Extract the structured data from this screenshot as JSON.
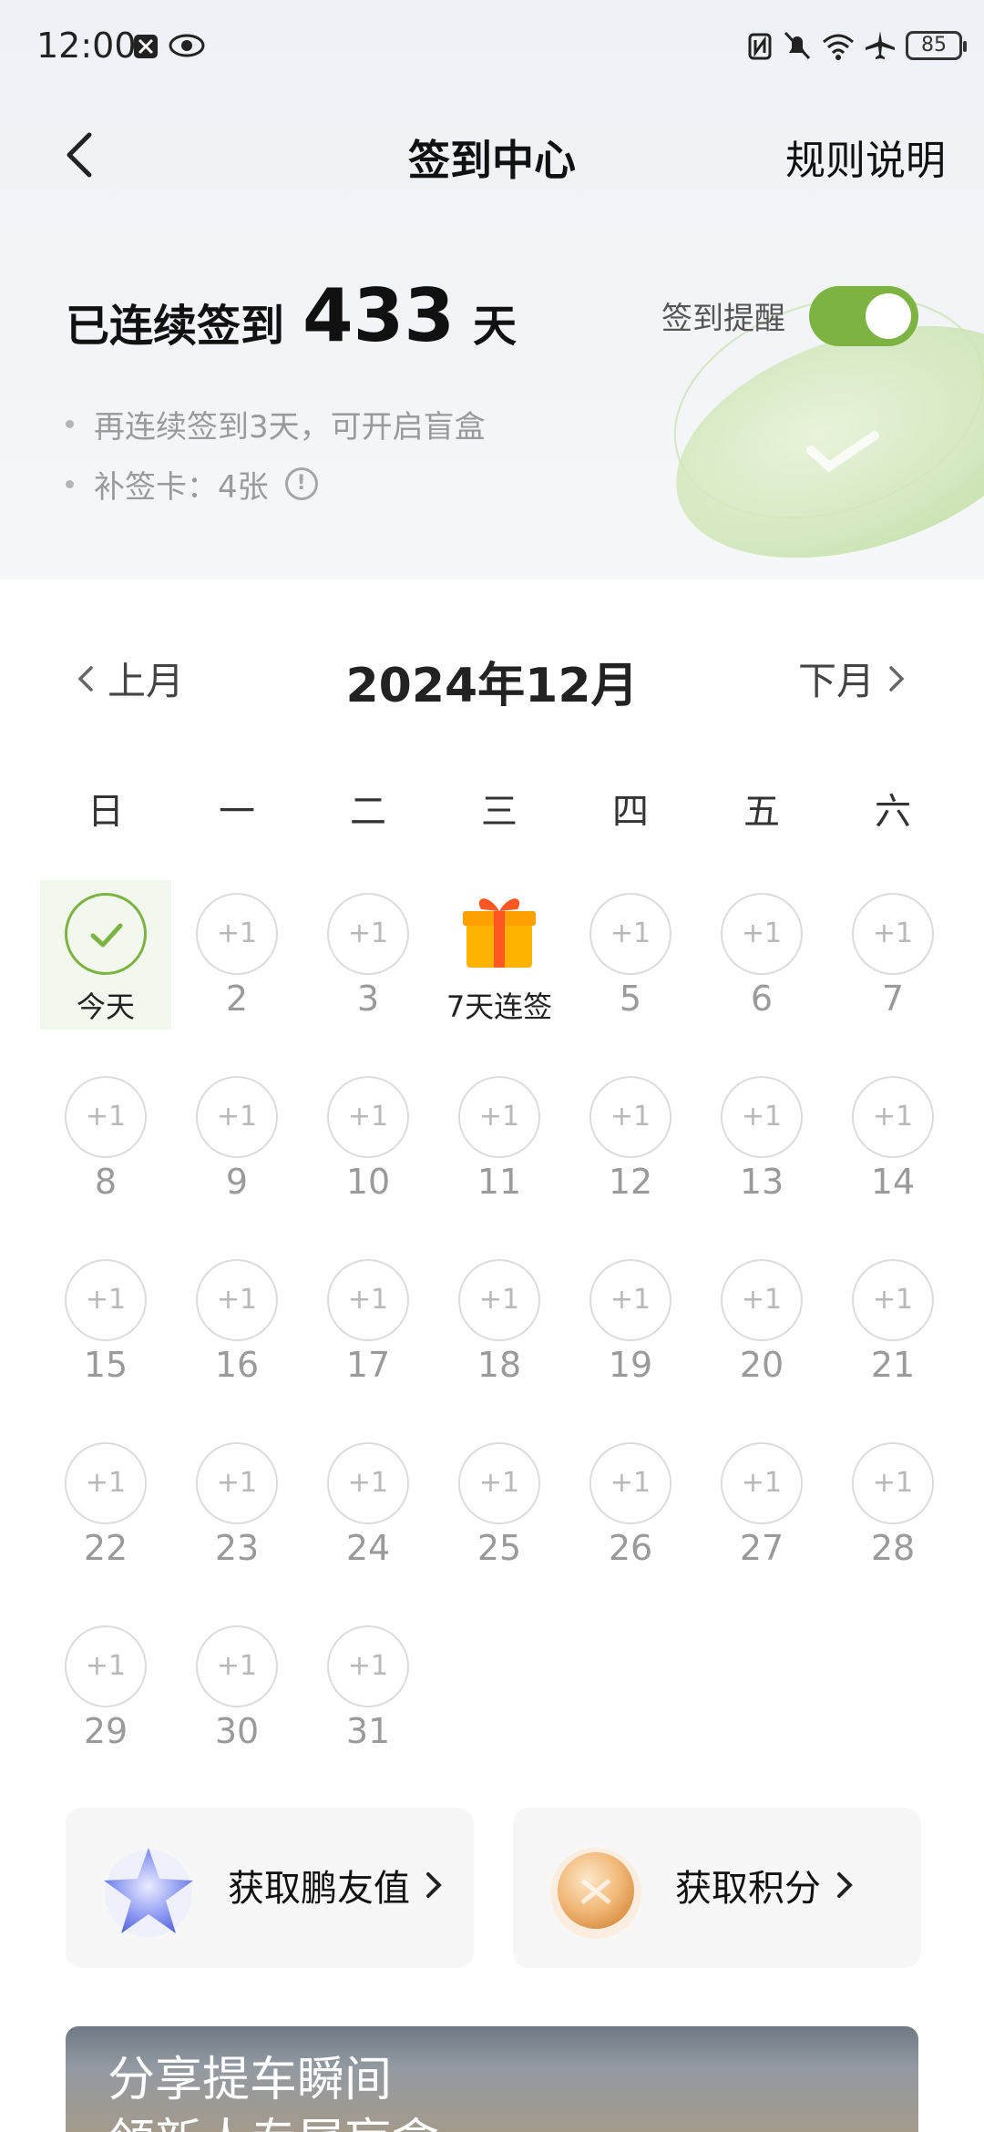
{
  "status_bar": {
    "time": "12:00",
    "battery": "85"
  },
  "header": {
    "title": "签到中心",
    "rules_link": "规则说明"
  },
  "streak": {
    "prefix": "已连续签到",
    "days": "433",
    "unit": "天"
  },
  "reminder": {
    "label": "签到提醒",
    "enabled": true
  },
  "tips": [
    "再连续签到3天，可开启盲盒",
    "补签卡：4张"
  ],
  "calendar": {
    "prev_label": "上月",
    "next_label": "下月",
    "month_title": "2024年12月",
    "weekdays": [
      "日",
      "一",
      "二",
      "三",
      "四",
      "五",
      "六"
    ],
    "plus_label": "+1",
    "today_label": "今天",
    "gift_label": "7天连签",
    "days": [
      {
        "label": "今天",
        "type": "today"
      },
      {
        "label": "2",
        "type": "plus"
      },
      {
        "label": "3",
        "type": "plus"
      },
      {
        "label": "7天连签",
        "type": "gift"
      },
      {
        "label": "5",
        "type": "plus"
      },
      {
        "label": "6",
        "type": "plus"
      },
      {
        "label": "7",
        "type": "plus"
      },
      {
        "label": "8",
        "type": "plus"
      },
      {
        "label": "9",
        "type": "plus"
      },
      {
        "label": "10",
        "type": "plus"
      },
      {
        "label": "11",
        "type": "plus"
      },
      {
        "label": "12",
        "type": "plus"
      },
      {
        "label": "13",
        "type": "plus"
      },
      {
        "label": "14",
        "type": "plus"
      },
      {
        "label": "15",
        "type": "plus"
      },
      {
        "label": "16",
        "type": "plus"
      },
      {
        "label": "17",
        "type": "plus"
      },
      {
        "label": "18",
        "type": "plus"
      },
      {
        "label": "19",
        "type": "plus"
      },
      {
        "label": "20",
        "type": "plus"
      },
      {
        "label": "21",
        "type": "plus"
      },
      {
        "label": "22",
        "type": "plus"
      },
      {
        "label": "23",
        "type": "plus"
      },
      {
        "label": "24",
        "type": "plus"
      },
      {
        "label": "25",
        "type": "plus"
      },
      {
        "label": "26",
        "type": "plus"
      },
      {
        "label": "27",
        "type": "plus"
      },
      {
        "label": "28",
        "type": "plus"
      },
      {
        "label": "29",
        "type": "plus"
      },
      {
        "label": "30",
        "type": "plus"
      },
      {
        "label": "31",
        "type": "plus"
      }
    ]
  },
  "cards": [
    {
      "label": "获取鹏友值",
      "icon": "star-icon"
    },
    {
      "label": "获取积分",
      "icon": "coin-icon"
    }
  ],
  "banner": {
    "line1": "分享提车瞬间",
    "line2": "领新人专属盲盒"
  },
  "colors": {
    "accent": "#7cb342",
    "today_bg": "#f3f8ee",
    "gift": "#ff9800"
  }
}
